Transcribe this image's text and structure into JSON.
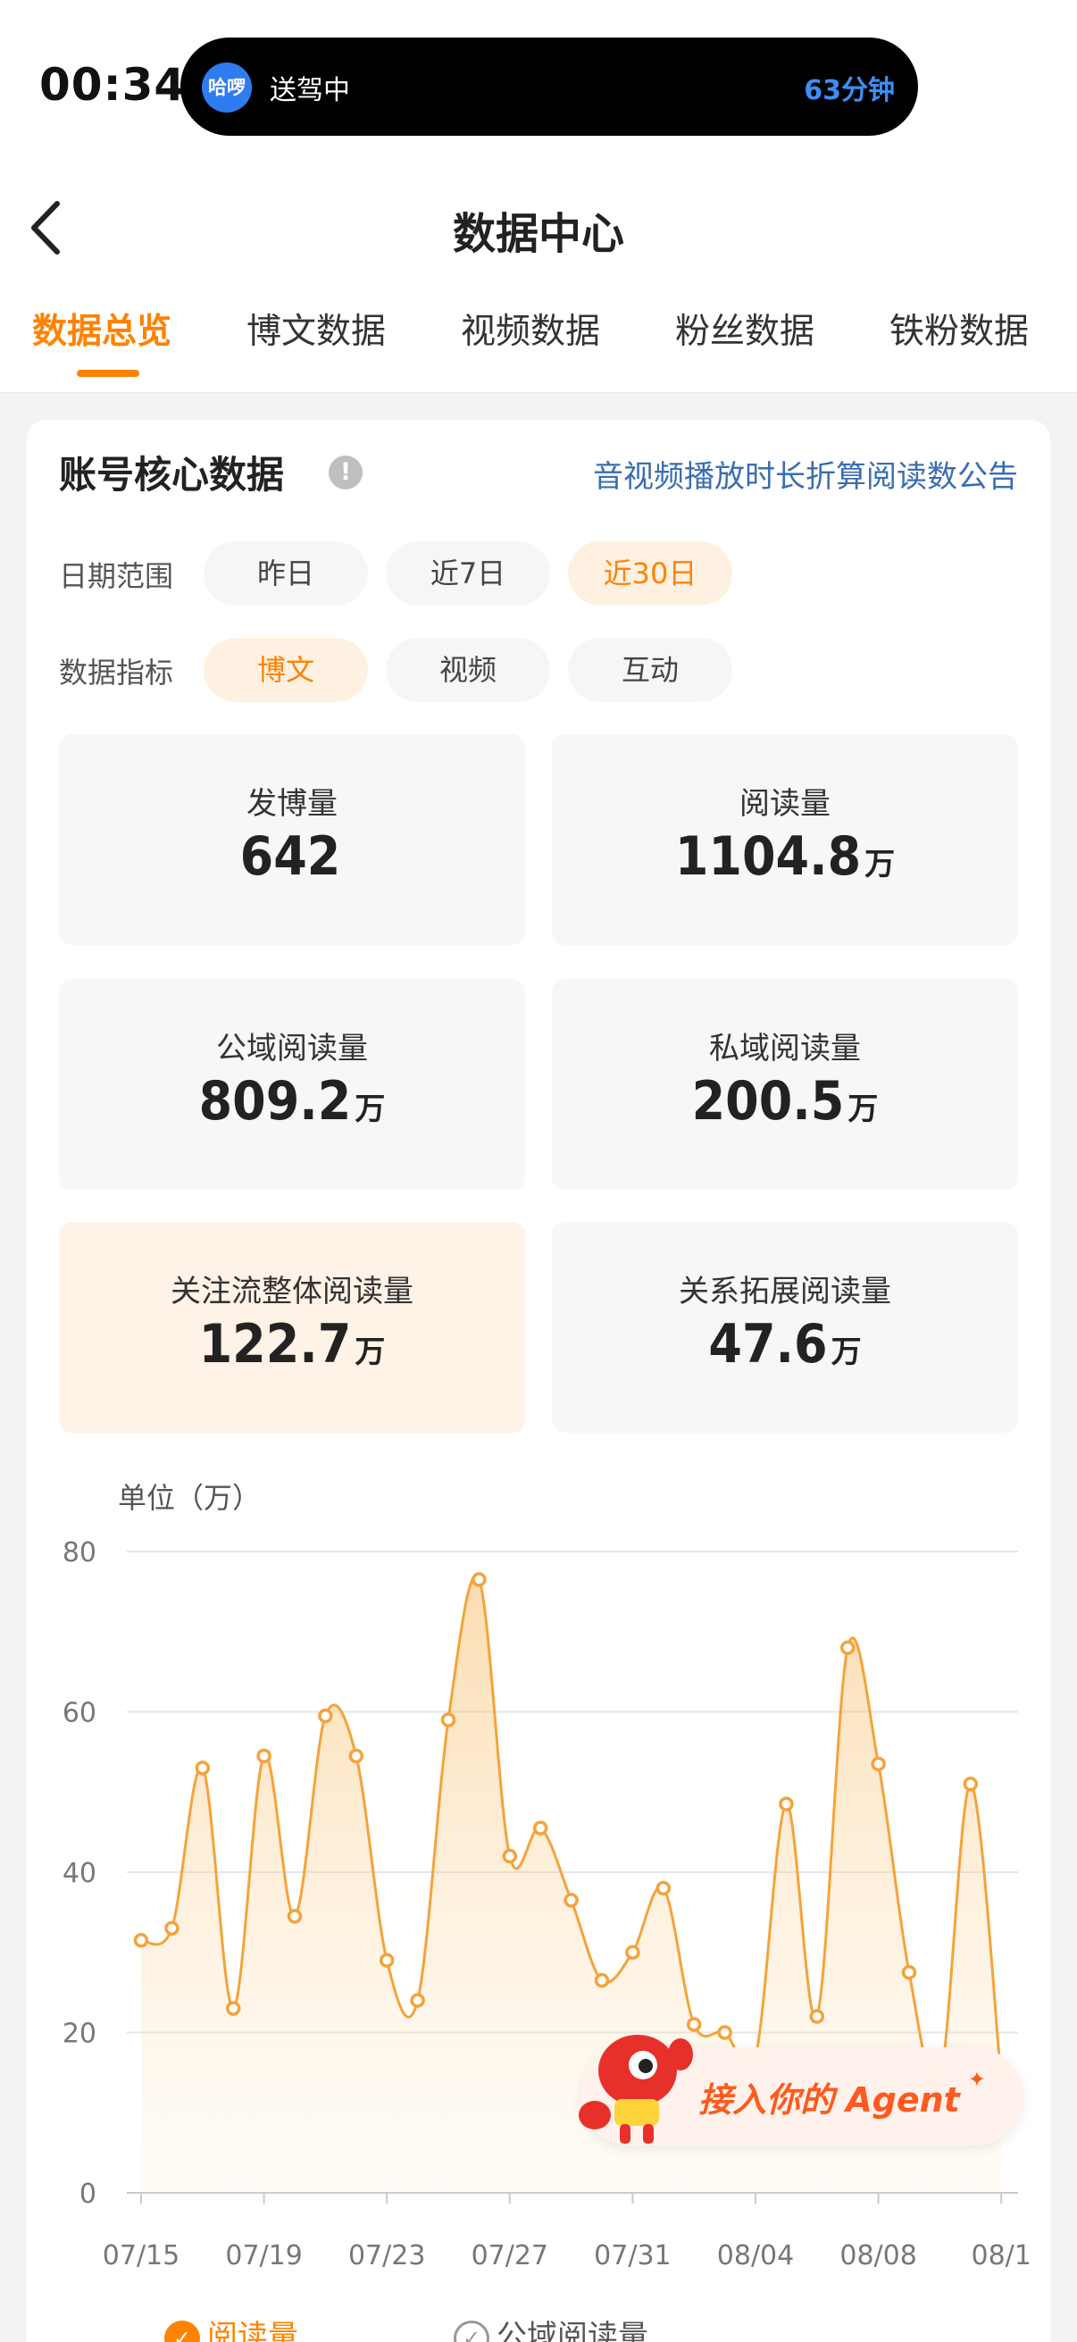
{
  "status_bar": {
    "time": "00:34",
    "island_app_logo_text": "哈啰",
    "island_text": "送驾中",
    "island_eta": "63分钟"
  },
  "header": {
    "title": "数据中心",
    "tabs": [
      {
        "label": "数据总览",
        "active": true
      },
      {
        "label": "博文数据",
        "active": false
      },
      {
        "label": "视频数据",
        "active": false
      },
      {
        "label": "粉丝数据",
        "active": false
      },
      {
        "label": "铁粉数据",
        "active": false
      }
    ]
  },
  "core": {
    "title": "账号核心数据",
    "info_icon_glyph": "!",
    "notice_link": "音视频播放时长折算阅读数公告",
    "date_range": {
      "label": "日期范围",
      "options": [
        "昨日",
        "近7日",
        "近30日"
      ],
      "selected": "近30日"
    },
    "metric_type": {
      "label": "数据指标",
      "options": [
        "博文",
        "视频",
        "互动"
      ],
      "selected": "博文"
    },
    "metrics": [
      {
        "label": "发博量",
        "value": "642",
        "unit": ""
      },
      {
        "label": "阅读量",
        "value": "1104.8",
        "unit": "万"
      },
      {
        "label": "公域阅读量",
        "value": "809.2",
        "unit": "万"
      },
      {
        "label": "私域阅读量",
        "value": "200.5",
        "unit": "万"
      },
      {
        "label": "关注流整体阅读量",
        "value": "122.7",
        "unit": "万",
        "highlight": true
      },
      {
        "label": "关系拓展阅读量",
        "value": "47.6",
        "unit": "万"
      }
    ]
  },
  "chart_data": {
    "type": "area",
    "unit_label": "单位（万）",
    "ylim": [
      0,
      80
    ],
    "yticks": [
      "0",
      "20",
      "40",
      "60",
      "80"
    ],
    "xtick_labels": [
      "07/15",
      "07/19",
      "07/23",
      "07/27",
      "07/31",
      "08/04",
      "08/08",
      "08/1"
    ],
    "x": [
      "07/15",
      "07/16",
      "07/17",
      "07/18",
      "07/19",
      "07/20",
      "07/21",
      "07/22",
      "07/23",
      "07/24",
      "07/25",
      "07/26",
      "07/27",
      "07/28",
      "07/29",
      "07/30",
      "07/31",
      "08/01",
      "08/02",
      "08/03",
      "08/04",
      "08/05",
      "08/06",
      "08/07",
      "08/08",
      "08/09",
      "08/10",
      "08/11",
      "08/12"
    ],
    "series": [
      {
        "name": "阅读量",
        "color": "#f5a33a",
        "values": [
          31.5,
          33,
          53,
          23,
          54.5,
          34.5,
          59.5,
          54.5,
          29,
          24,
          59,
          76.5,
          42,
          45.5,
          36.5,
          26.5,
          30,
          38,
          21,
          20,
          17,
          48.5,
          22,
          68,
          53.5,
          27.5,
          14,
          51,
          14
        ]
      }
    ],
    "grid": true,
    "legend": [
      {
        "label": "阅读量",
        "checked": true,
        "color": "#ff8200"
      },
      {
        "label": "公域阅读量",
        "checked": false,
        "color": "#999999"
      }
    ]
  },
  "agent_banner": {
    "text": "接入你的 Agent",
    "spark": "✦"
  }
}
